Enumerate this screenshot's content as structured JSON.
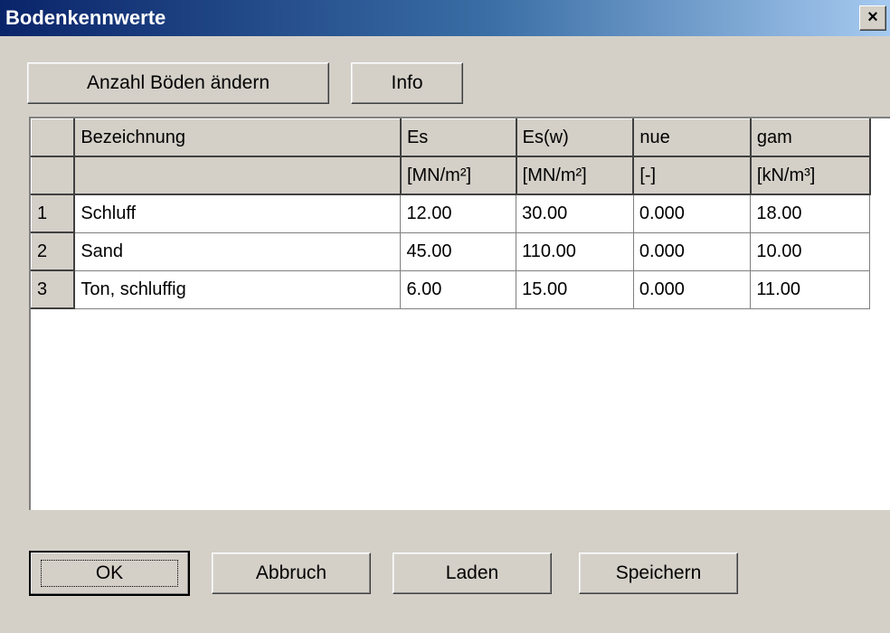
{
  "window": {
    "title": "Bodenkennwerte",
    "close_glyph": "×"
  },
  "buttons": {
    "anzahl": "Anzahl Böden ändern",
    "info": "Info",
    "ok": "OK",
    "abbruch": "Abbruch",
    "laden": "Laden",
    "speichern": "Speichern"
  },
  "grid": {
    "headers": [
      "Bezeichnung",
      "Es",
      "Es(w)",
      "nue",
      "gam"
    ],
    "units": [
      "",
      "[MN/m²]",
      "[MN/m²]",
      "[-]",
      "[kN/m³]"
    ],
    "rows": [
      {
        "num": "1",
        "name": "Schluff",
        "es": "12.00",
        "esw": "30.00",
        "nue": "0.000",
        "gam": "18.00"
      },
      {
        "num": "2",
        "name": "Sand",
        "es": "45.00",
        "esw": "110.00",
        "nue": "0.000",
        "gam": "10.00"
      },
      {
        "num": "3",
        "name": "Ton, schluffig",
        "es": "6.00",
        "esw": "15.00",
        "nue": "0.000",
        "gam": "11.00"
      }
    ]
  }
}
